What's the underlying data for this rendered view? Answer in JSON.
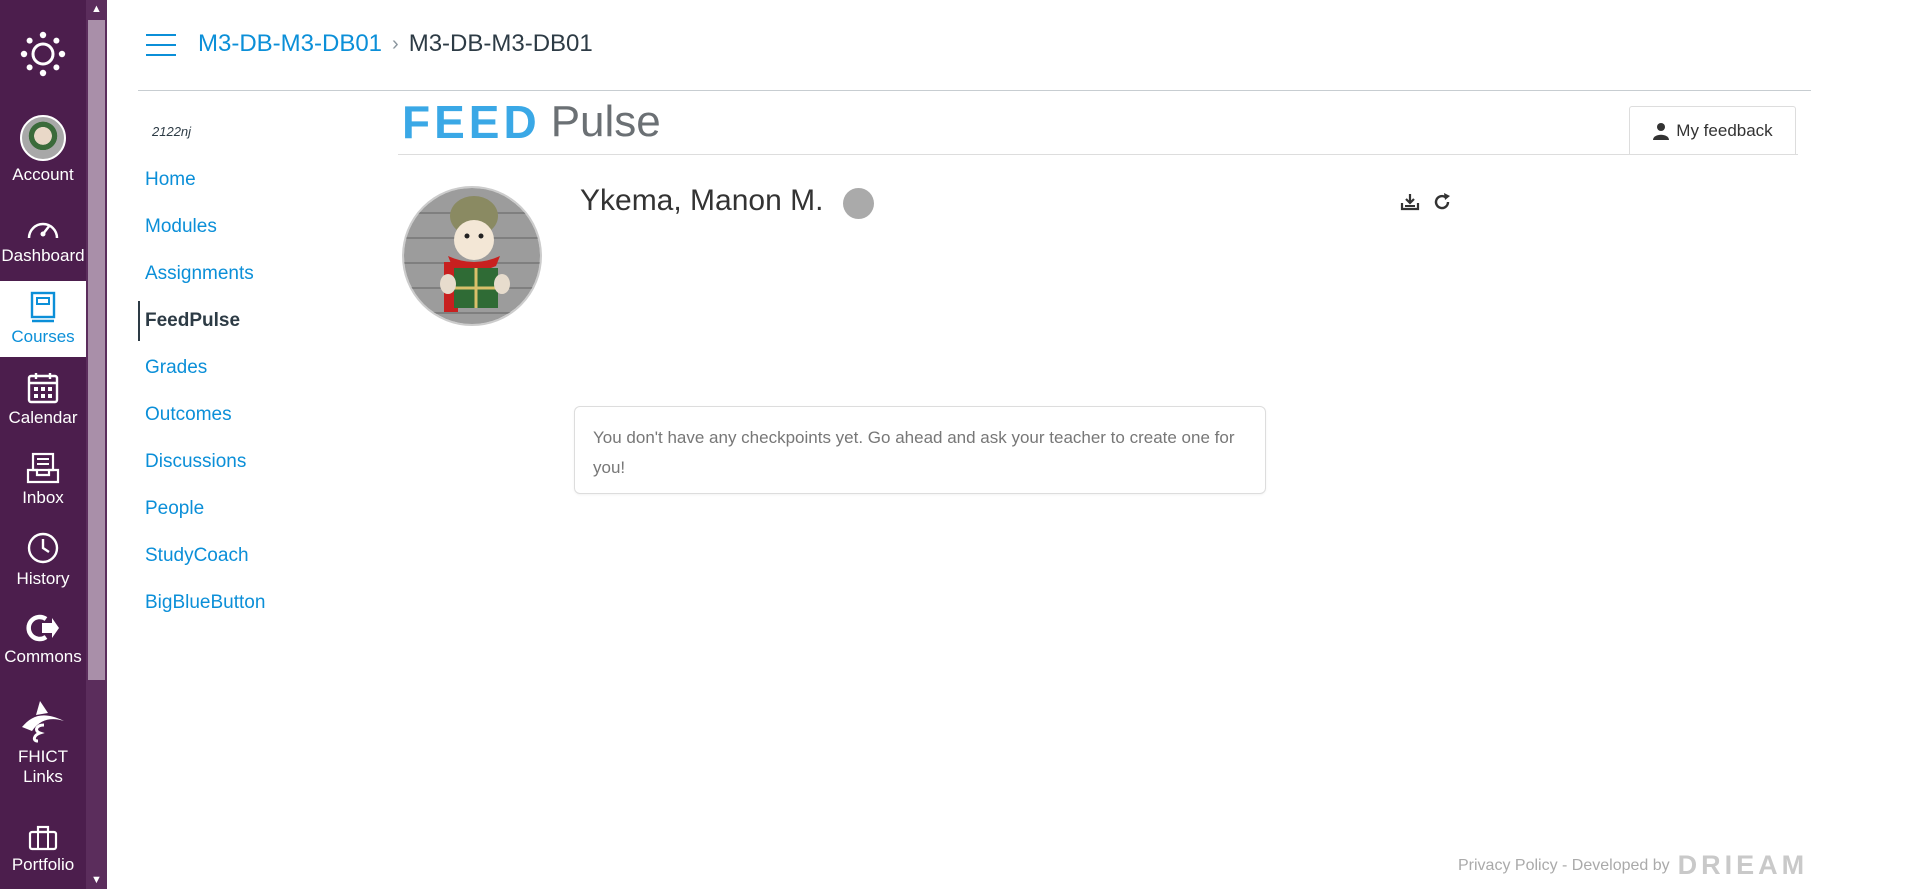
{
  "global_nav": {
    "items": [
      {
        "label": "Account",
        "icon": "account-avatar"
      },
      {
        "label": "Dashboard",
        "icon": "dashboard-gauge-icon"
      },
      {
        "label": "Courses",
        "icon": "courses-book-icon",
        "active": true
      },
      {
        "label": "Calendar",
        "icon": "calendar-icon"
      },
      {
        "label": "Inbox",
        "icon": "inbox-icon"
      },
      {
        "label": "History",
        "icon": "history-clock-icon"
      },
      {
        "label": "Commons",
        "icon": "commons-icon"
      },
      {
        "label": "FHICT Links",
        "icon": "fhict-links-icon"
      },
      {
        "label": "Portfolio",
        "icon": "portfolio-briefcase-icon"
      }
    ]
  },
  "header": {
    "breadcrumb_link": "M3-DB-M3-DB01",
    "breadcrumb_current": "M3-DB-M3-DB01"
  },
  "course_nav": {
    "term": "2122nj",
    "items": [
      {
        "label": "Home"
      },
      {
        "label": "Modules"
      },
      {
        "label": "Assignments"
      },
      {
        "label": "FeedPulse",
        "active": true
      },
      {
        "label": "Grades"
      },
      {
        "label": "Outcomes"
      },
      {
        "label": "Discussions"
      },
      {
        "label": "People"
      },
      {
        "label": "StudyCoach"
      },
      {
        "label": "BigBlueButton"
      }
    ]
  },
  "feedpulse": {
    "logo_feed": "FEED",
    "logo_pulse": "Pulse",
    "my_feedback_label": "My feedback",
    "student_name": "Ykema, Manon M.",
    "empty_message": "You don't have any checkpoints yet. Go ahead and ask your teacher to create one for you!",
    "footer_text": "Privacy Policy - Developed by",
    "footer_brand": "DRIEAM"
  },
  "colors": {
    "nav_bg": "#4c1e4d",
    "link": "#0b8fd8",
    "feedpulse_blue": "#3aa8e6",
    "status_grey": "#aaaaaa"
  }
}
